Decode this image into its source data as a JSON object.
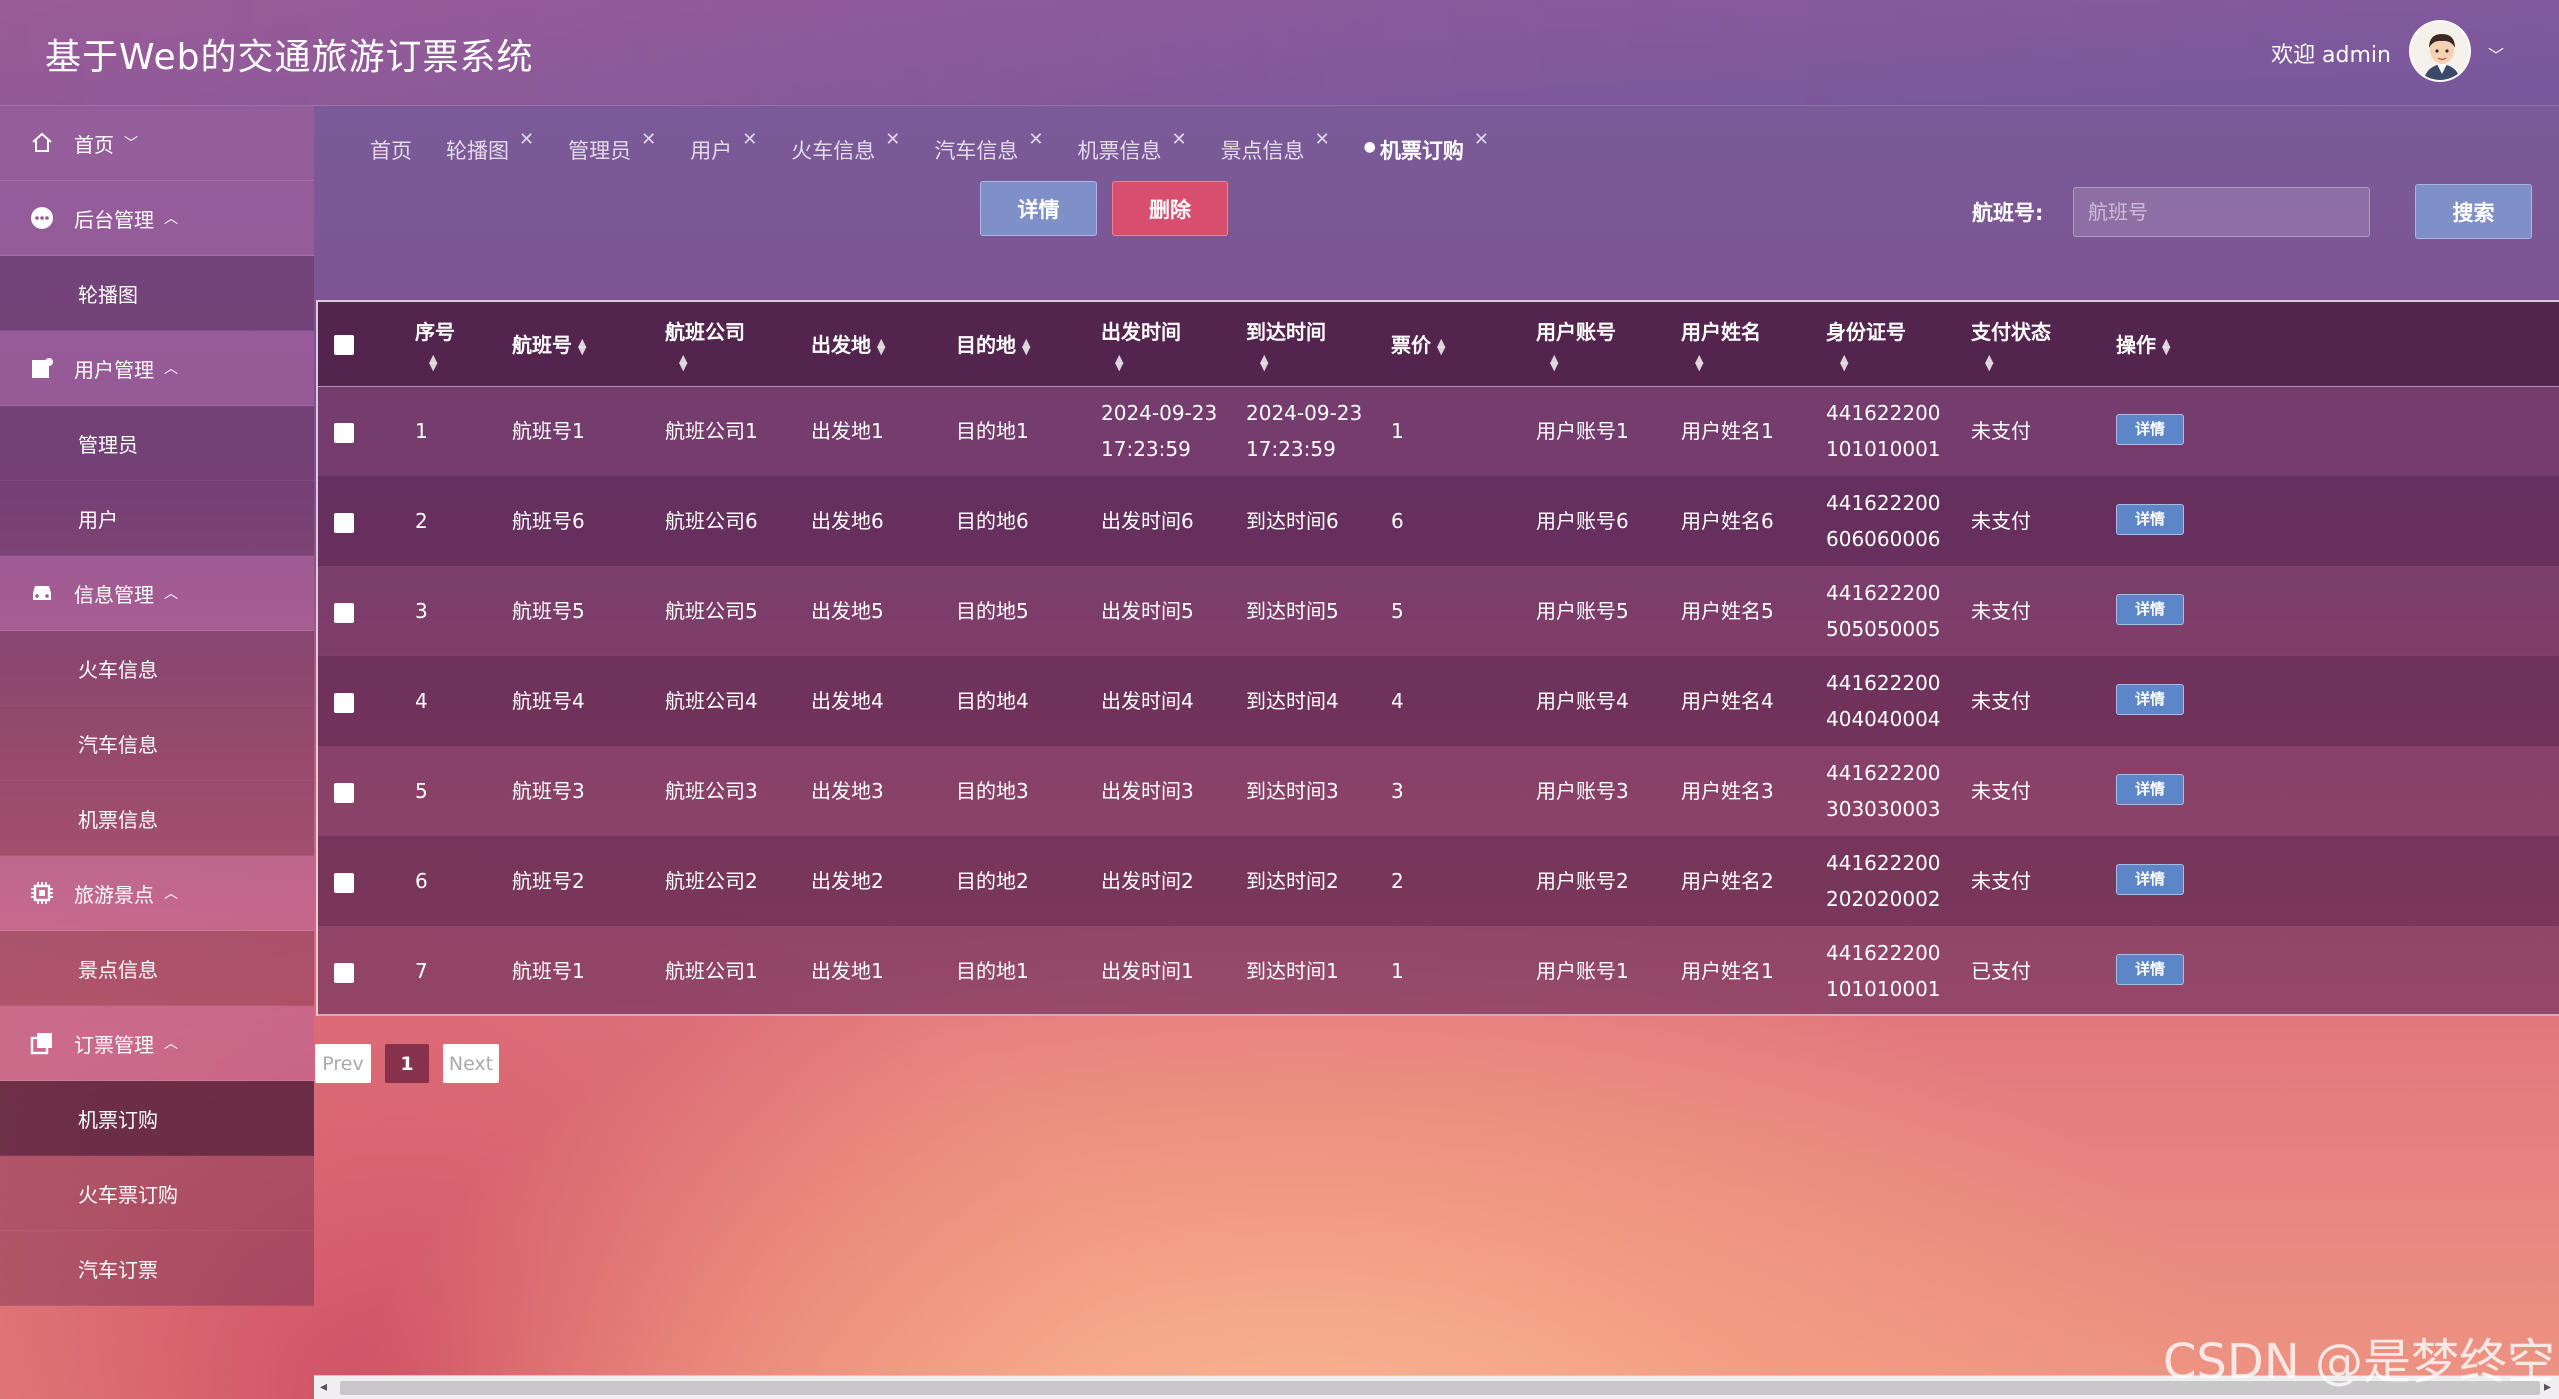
{
  "header": {
    "title": "基于Web的交通旅游订票系统",
    "welcome": "欢迎 admin"
  },
  "sidebar": {
    "groups": [
      {
        "label": "首页",
        "icon": "home-icon",
        "chev": "﹀",
        "children": []
      },
      {
        "label": "后台管理",
        "icon": "chat-icon",
        "chev": "︿",
        "children": [
          {
            "label": "轮播图"
          }
        ]
      },
      {
        "label": "用户管理",
        "icon": "user-card-icon",
        "chev": "︿",
        "children": [
          {
            "label": "管理员"
          },
          {
            "label": "用户"
          }
        ]
      },
      {
        "label": "信息管理",
        "icon": "car-icon",
        "chev": "︿",
        "children": [
          {
            "label": "火车信息"
          },
          {
            "label": "汽车信息"
          },
          {
            "label": "机票信息"
          }
        ]
      },
      {
        "label": "旅游景点",
        "icon": "chip-icon",
        "chev": "︿",
        "children": [
          {
            "label": "景点信息"
          }
        ]
      },
      {
        "label": "订票管理",
        "icon": "copy-icon",
        "chev": "︿",
        "children": [
          {
            "label": "机票订购",
            "active": true
          },
          {
            "label": "火车票订购"
          },
          {
            "label": "汽车订票"
          }
        ]
      }
    ]
  },
  "tabs": [
    {
      "label": "首页",
      "closable": false
    },
    {
      "label": "轮播图",
      "closable": true
    },
    {
      "label": "管理员",
      "closable": true
    },
    {
      "label": "用户",
      "closable": true
    },
    {
      "label": "火车信息",
      "closable": true
    },
    {
      "label": "汽车信息",
      "closable": true
    },
    {
      "label": "机票信息",
      "closable": true
    },
    {
      "label": "景点信息",
      "closable": true
    },
    {
      "label": "机票订购",
      "closable": true,
      "active": true
    }
  ],
  "toolbar": {
    "detail_label": "详情",
    "delete_label": "删除",
    "search_label": "航班号:",
    "search_placeholder": "航班号",
    "search_button": "搜索"
  },
  "table": {
    "columns": [
      {
        "label": "序号",
        "sort": "below"
      },
      {
        "label": "航班号",
        "sort": "inline"
      },
      {
        "label": "航班公司",
        "sort": "below"
      },
      {
        "label": "出发地",
        "sort": "inline"
      },
      {
        "label": "目的地",
        "sort": "inline"
      },
      {
        "label": "出发时间",
        "sort": "below"
      },
      {
        "label": "到达时间",
        "sort": "below"
      },
      {
        "label": "票价",
        "sort": "inline"
      },
      {
        "label": "用户账号",
        "sort": "below"
      },
      {
        "label": "用户姓名",
        "sort": "below"
      },
      {
        "label": "身份证号",
        "sort": "below"
      },
      {
        "label": "支付状态",
        "sort": "below"
      },
      {
        "label": "操作",
        "sort": "inline"
      }
    ],
    "row_action": "详情",
    "rows": [
      {
        "no": "1",
        "flight": "航班号1",
        "company": "航班公司1",
        "from": "出发地1",
        "to": "目的地1",
        "depart": [
          "2024-09-23",
          "17:23:59"
        ],
        "arrive": [
          "2024-09-23",
          "17:23:59"
        ],
        "price": "1",
        "account": "用户账号1",
        "name": "用户姓名1",
        "idcard": [
          "441622200",
          "101010001"
        ],
        "status": "未支付"
      },
      {
        "no": "2",
        "flight": "航班号6",
        "company": "航班公司6",
        "from": "出发地6",
        "to": "目的地6",
        "depart": [
          "出发时间6"
        ],
        "arrive": [
          "到达时间6"
        ],
        "price": "6",
        "account": "用户账号6",
        "name": "用户姓名6",
        "idcard": [
          "441622200",
          "606060006"
        ],
        "status": "未支付"
      },
      {
        "no": "3",
        "flight": "航班号5",
        "company": "航班公司5",
        "from": "出发地5",
        "to": "目的地5",
        "depart": [
          "出发时间5"
        ],
        "arrive": [
          "到达时间5"
        ],
        "price": "5",
        "account": "用户账号5",
        "name": "用户姓名5",
        "idcard": [
          "441622200",
          "505050005"
        ],
        "status": "未支付"
      },
      {
        "no": "4",
        "flight": "航班号4",
        "company": "航班公司4",
        "from": "出发地4",
        "to": "目的地4",
        "depart": [
          "出发时间4"
        ],
        "arrive": [
          "到达时间4"
        ],
        "price": "4",
        "account": "用户账号4",
        "name": "用户姓名4",
        "idcard": [
          "441622200",
          "404040004"
        ],
        "status": "未支付"
      },
      {
        "no": "5",
        "flight": "航班号3",
        "company": "航班公司3",
        "from": "出发地3",
        "to": "目的地3",
        "depart": [
          "出发时间3"
        ],
        "arrive": [
          "到达时间3"
        ],
        "price": "3",
        "account": "用户账号3",
        "name": "用户姓名3",
        "idcard": [
          "441622200",
          "303030003"
        ],
        "status": "未支付"
      },
      {
        "no": "6",
        "flight": "航班号2",
        "company": "航班公司2",
        "from": "出发地2",
        "to": "目的地2",
        "depart": [
          "出发时间2"
        ],
        "arrive": [
          "到达时间2"
        ],
        "price": "2",
        "account": "用户账号2",
        "name": "用户姓名2",
        "idcard": [
          "441622200",
          "202020002"
        ],
        "status": "未支付"
      },
      {
        "no": "7",
        "flight": "航班号1",
        "company": "航班公司1",
        "from": "出发地1",
        "to": "目的地1",
        "depart": [
          "出发时间1"
        ],
        "arrive": [
          "到达时间1"
        ],
        "price": "1",
        "account": "用户账号1",
        "name": "用户姓名1",
        "idcard": [
          "441622200",
          "101010001"
        ],
        "status": "已支付"
      }
    ]
  },
  "pagination": {
    "prev": "Prev",
    "current": "1",
    "next": "Next"
  },
  "watermark": "CSDN @是梦终空",
  "colors": {
    "detail_button": "#7f90c9",
    "delete_button": "#d84e6e",
    "row_detail_button": "#5d86c8",
    "active_page": "#782846"
  }
}
